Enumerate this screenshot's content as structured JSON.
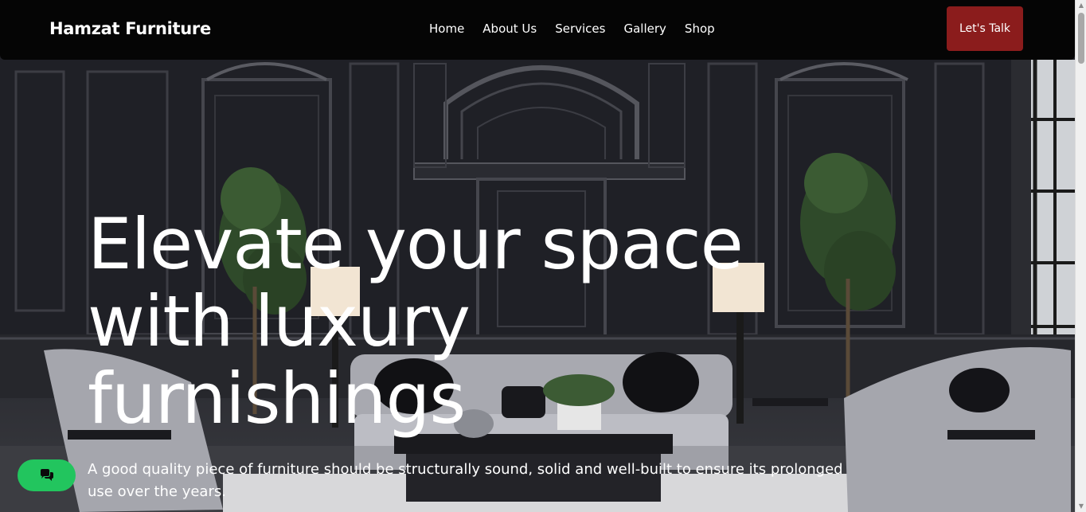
{
  "brand": {
    "name": "Hamzat Furniture"
  },
  "nav": {
    "links": [
      "Home",
      "About Us",
      "Services",
      "Gallery",
      "Shop"
    ],
    "cta_label": "Let's Talk"
  },
  "hero": {
    "headline_lines": [
      "Elevate your space",
      "with luxury",
      "furnishings"
    ],
    "subtext": "A good quality piece of furniture should be structurally sound, solid and well-built to ensure its prolonged use over the years."
  },
  "chat": {
    "icon": "chat-bubbles-icon"
  },
  "colors": {
    "navbar_bg": "#050505",
    "cta_bg": "#8b1c1c",
    "chat_bg": "#22c55e",
    "text": "#ffffff"
  }
}
